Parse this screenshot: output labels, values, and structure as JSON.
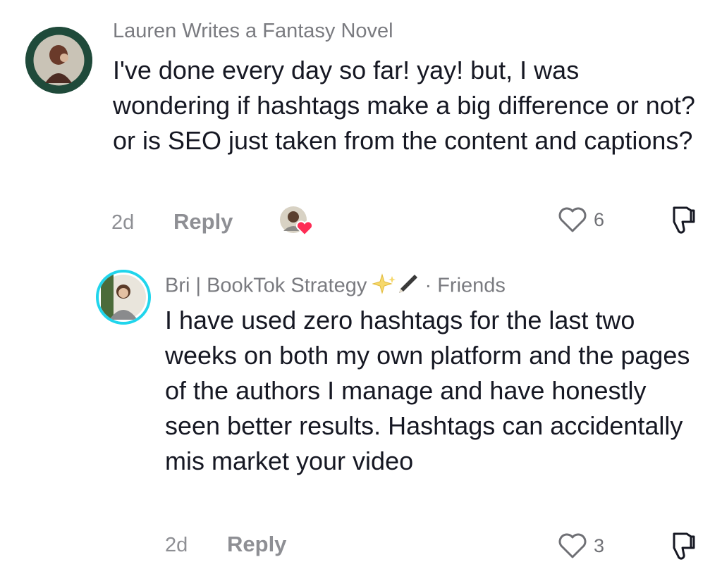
{
  "comments": [
    {
      "username": "Lauren Writes a Fantasy Novel",
      "text": "I've done every day so far! yay! but, I was wondering if hashtags make a big difference or not? or is SEO just taken from the content and captions?",
      "time": "2d",
      "reply_label": "Reply",
      "like_count": "6",
      "liked_by_creator": true
    },
    {
      "username": "Bri | BookTok Strategy",
      "username_emoji": "✨🖊",
      "relation": "· Friends",
      "text": "I have used zero hashtags for the last two weeks on both my own platform and the pages of the authors I manage and have honestly seen better results. Hashtags can accidentally mis market your video",
      "time": "2d",
      "reply_label": "Reply",
      "like_count": "3"
    }
  ],
  "colors": {
    "text": "#161823",
    "muted": "#8e8f94",
    "creator_heart": "#fe2c55",
    "story_ring": "#20d5ec"
  },
  "icons": [
    "heart-outline-icon",
    "dislike-icon",
    "creator-heart-icon"
  ]
}
